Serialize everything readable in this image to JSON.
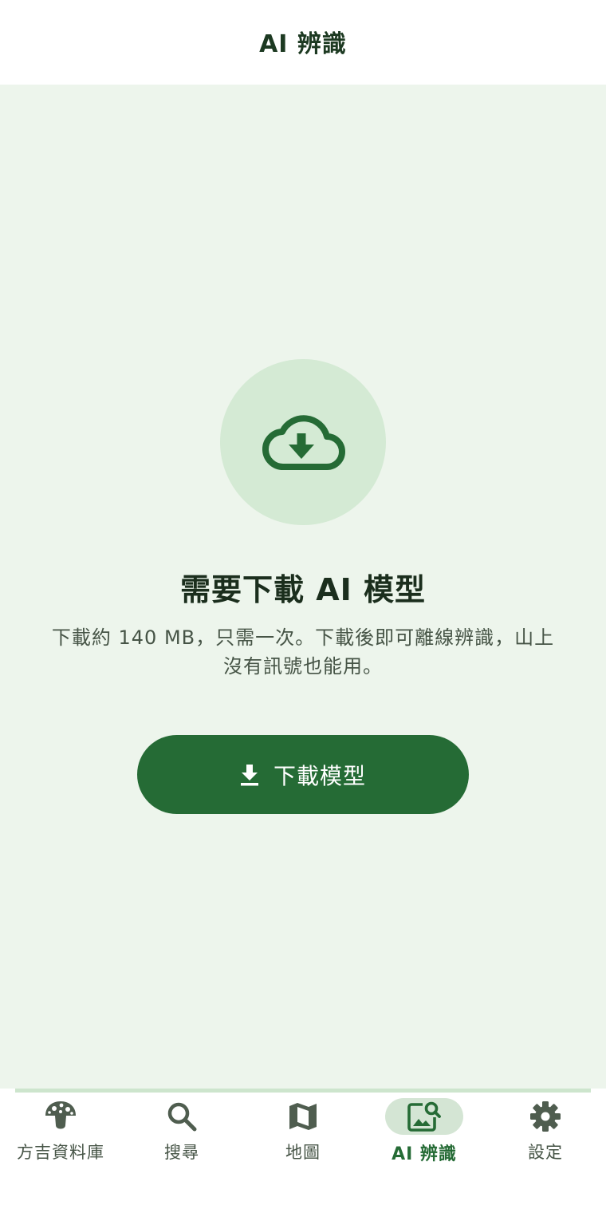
{
  "header": {
    "title": "AI 辨識"
  },
  "main": {
    "icon": "cloud-download-icon",
    "headline": "需要下載 AI 模型",
    "description": "下載約 140 MB，只需一次。下載後即可離線辨識，山上沒有訊號也能用。",
    "download_button": {
      "label": "下載模型",
      "icon": "download-icon"
    }
  },
  "nav": {
    "items": [
      {
        "label": "方吉資料庫",
        "icon": "mushroom-icon",
        "active": false
      },
      {
        "label": "搜尋",
        "icon": "search-icon",
        "active": false
      },
      {
        "label": "地圖",
        "icon": "map-icon",
        "active": false
      },
      {
        "label": "AI 辨識",
        "icon": "image-search-icon",
        "active": true
      },
      {
        "label": "設定",
        "icon": "gear-icon",
        "active": false
      }
    ]
  },
  "colors": {
    "primary": "#256b35",
    "background": "#edf5ec",
    "icon_circle": "#d4ead4",
    "active_pill": "#d4e5d4",
    "text_dark": "#1b2e1d",
    "text_muted": "#465446"
  }
}
